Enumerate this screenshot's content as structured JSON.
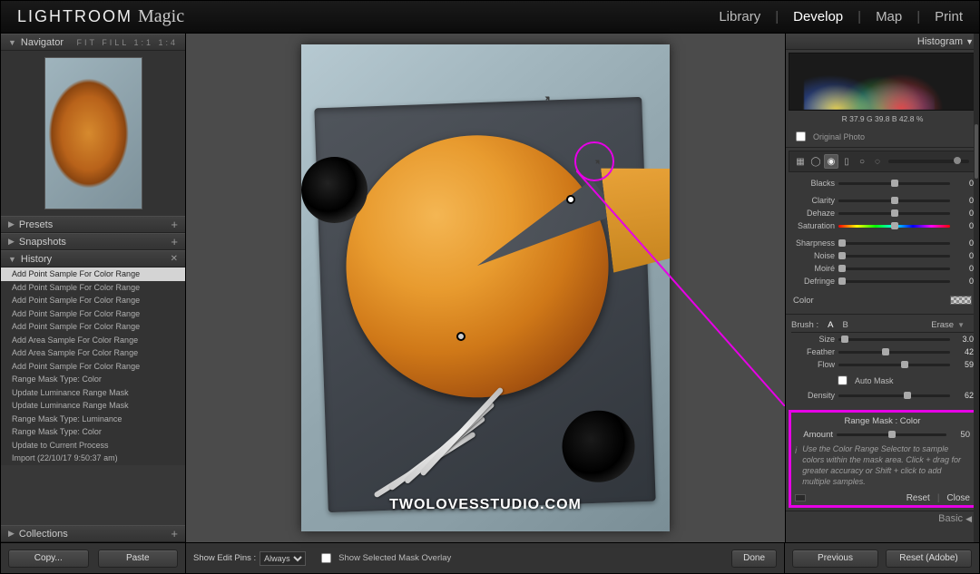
{
  "app": {
    "brand": "LIGHTROOM",
    "sub": "Magic"
  },
  "modules": {
    "library": "Library",
    "develop": "Develop",
    "map": "Map",
    "print": "Print"
  },
  "left": {
    "navigator": {
      "title": "Navigator",
      "modes": "FIT  FILL  1:1  1:4"
    },
    "presets": {
      "title": "Presets"
    },
    "snapshots": {
      "title": "Snapshots"
    },
    "history": {
      "title": "History",
      "items": [
        "Add Point Sample For Color Range",
        "Add Point Sample For Color Range",
        "Add Point Sample For Color Range",
        "Add Point Sample For Color Range",
        "Add Point Sample For Color Range",
        "Add Area Sample For Color Range",
        "Add Area Sample For Color Range",
        "Add Point Sample For Color Range",
        "Range Mask Type: Color",
        "Update Luminance Range Mask",
        "Update Luminance Range Mask",
        "Range Mask Type: Luminance",
        "Range Mask Type: Color",
        "Update to Current Process",
        "Import (22/10/17 9:50:37 am)"
      ]
    },
    "collections": {
      "title": "Collections"
    }
  },
  "right": {
    "histogram": {
      "title": "Histogram",
      "rgb": "R   37.9   G   39.8   B   42.8   %"
    },
    "original": "Original Photo",
    "sliders": {
      "blacks": {
        "label": "Blacks",
        "value": "0"
      },
      "clarity": {
        "label": "Clarity",
        "value": "0"
      },
      "dehaze": {
        "label": "Dehaze",
        "value": "0"
      },
      "saturation": {
        "label": "Saturation",
        "value": "0"
      },
      "sharpness": {
        "label": "Sharpness",
        "value": "0"
      },
      "noise": {
        "label": "Noise",
        "value": "0"
      },
      "moire": {
        "label": "Moiré",
        "value": "0"
      },
      "defringe": {
        "label": "Defringe",
        "value": "0"
      }
    },
    "color": {
      "label": "Color"
    },
    "brush": {
      "label": "Brush :",
      "a": "A",
      "b": "B",
      "erase": "Erase",
      "size": {
        "label": "Size",
        "value": "3.0"
      },
      "feather": {
        "label": "Feather",
        "value": "42"
      },
      "flow": {
        "label": "Flow",
        "value": "59"
      },
      "automask": "Auto Mask",
      "density": {
        "label": "Density",
        "value": "62"
      }
    },
    "range": {
      "title": "Range Mask : Color",
      "amount": {
        "label": "Amount",
        "value": "50"
      },
      "info": "Use the Color Range Selector to sample colors within the mask area. Click + drag for greater accuracy or Shift + click to add multiple samples.",
      "reset": "Reset",
      "close": "Close"
    },
    "basic": "Basic"
  },
  "bottom": {
    "copy": "Copy...",
    "paste": "Paste",
    "pins": {
      "label": "Show Edit Pins :",
      "value": "Always"
    },
    "overlay": "Show Selected Mask Overlay",
    "done": "Done",
    "previous": "Previous",
    "reset": "Reset (Adobe)"
  },
  "watermark": "TWOLOVESSTUDIO.COM"
}
